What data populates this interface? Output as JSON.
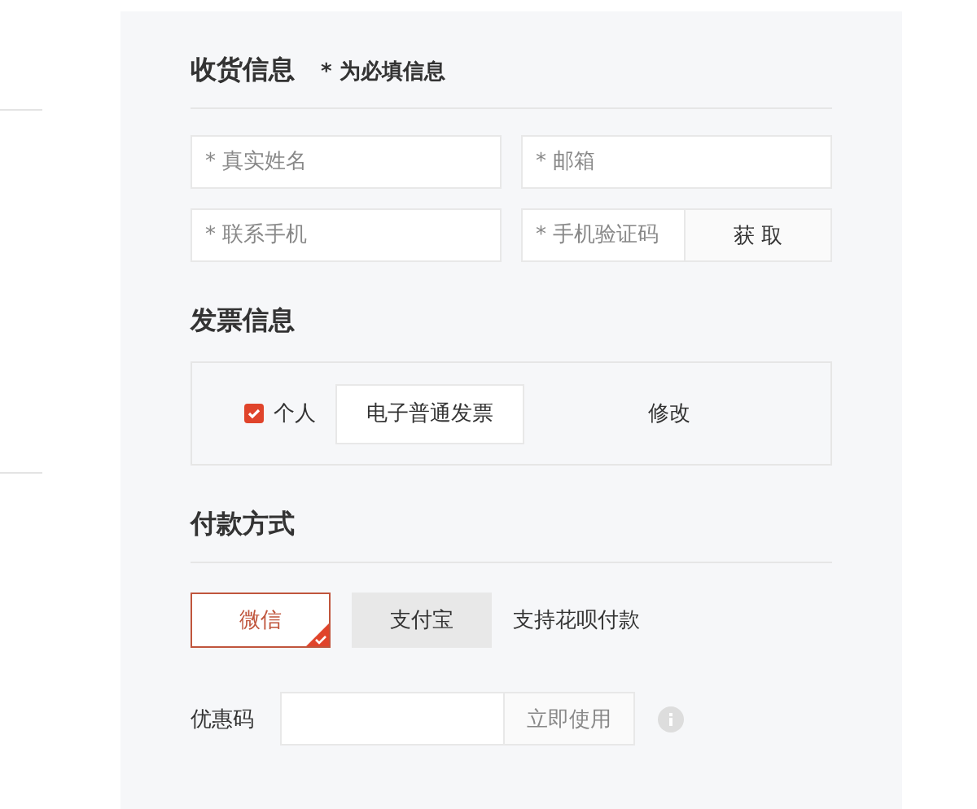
{
  "shipping": {
    "title": "收货信息",
    "note": "* 为必填信息",
    "fields": [
      {
        "kind": "plain",
        "placeholder": "* 真实姓名"
      },
      {
        "kind": "plain",
        "placeholder": "* 邮箱"
      },
      {
        "kind": "plain",
        "placeholder": "* 联系手机"
      },
      {
        "kind": "with_button",
        "placeholder": "* 手机验证码",
        "button": "获 取"
      }
    ]
  },
  "invoice": {
    "title": "发票信息",
    "option": {
      "label": "个人",
      "checked": true
    },
    "type_button": "电子普通发票",
    "edit_link": "修改"
  },
  "payment": {
    "title": "付款方式",
    "methods": [
      {
        "label": "微信",
        "selected": true
      },
      {
        "label": "支付宝",
        "selected": false
      }
    ],
    "note": "支持花呗付款"
  },
  "coupon": {
    "label": "优惠码",
    "button": "立即使用"
  }
}
